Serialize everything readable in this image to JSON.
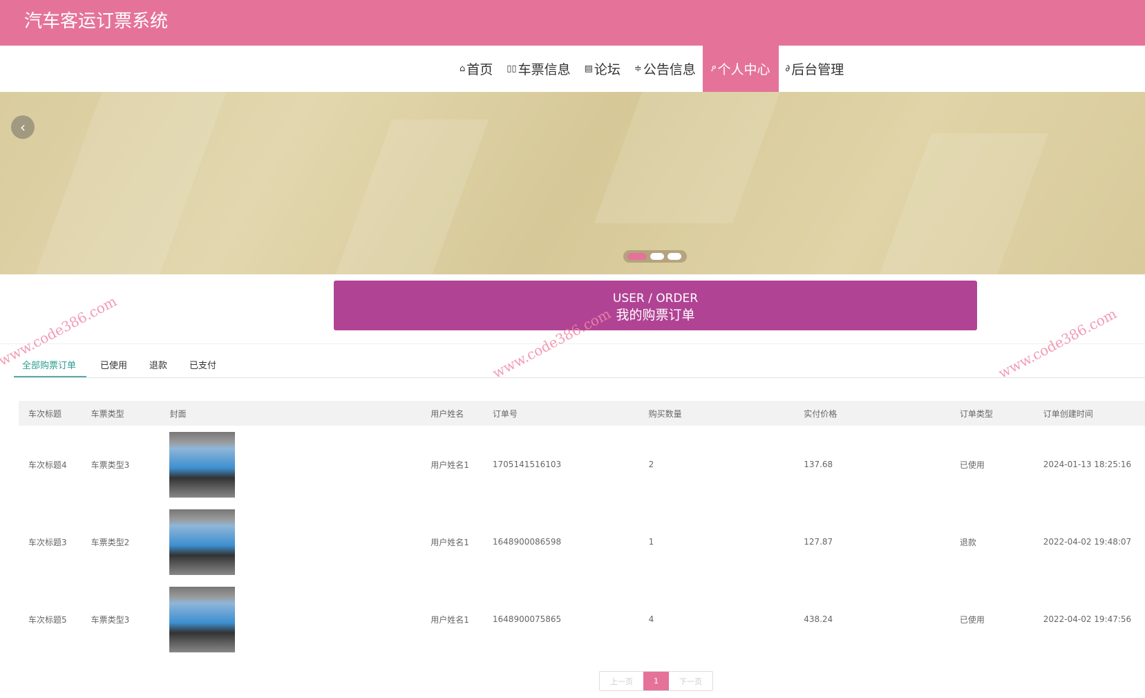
{
  "header": {
    "title": "汽车客运订票系统"
  },
  "nav": {
    "items": [
      {
        "icon": "home-icon",
        "glyph": "⌂",
        "label": "首页"
      },
      {
        "icon": "ticket-icon",
        "glyph": "▯▯",
        "label": "车票信息"
      },
      {
        "icon": "forum-icon",
        "glyph": "▤",
        "label": "论坛"
      },
      {
        "icon": "sliders-icon",
        "glyph": "≑",
        "label": "公告信息"
      },
      {
        "icon": "user-icon",
        "glyph": "ዖ",
        "label": "个人中心",
        "active": true
      },
      {
        "icon": "link-icon",
        "glyph": "∂",
        "label": "后台管理"
      }
    ]
  },
  "banner": {
    "prev_glyph": "‹",
    "slides": 3,
    "active_slide": 1
  },
  "section": {
    "en": "USER / ORDER",
    "cn": "我的购票订单"
  },
  "tabs": [
    "全部购票订单",
    "已使用",
    "退款",
    "已支付"
  ],
  "table": {
    "columns": [
      "车次标题",
      "车票类型",
      "封面",
      "用户姓名",
      "订单号",
      "购买数量",
      "实付价格",
      "订单类型",
      "订单创建时间"
    ],
    "rows": [
      [
        "车次标题4",
        "车票类型3",
        "",
        "用户姓名1",
        "1705141516103",
        "2",
        "137.68",
        "已使用",
        "2024-01-13 18:25:16"
      ],
      [
        "车次标题3",
        "车票类型2",
        "",
        "用户姓名1",
        "1648900086598",
        "1",
        "127.87",
        "退款",
        "2022-04-02 19:48:07"
      ],
      [
        "车次标题5",
        "车票类型3",
        "",
        "用户姓名1",
        "1648900075865",
        "4",
        "438.24",
        "已使用",
        "2022-04-02 19:47:56"
      ]
    ]
  },
  "pagination": {
    "prev": "上一页",
    "current": "1",
    "next": "下一页"
  },
  "watermark": "www.code386.com",
  "colors": {
    "brand": "#e57399",
    "section": "#b04394",
    "tab_active": "#2a9d8f"
  }
}
